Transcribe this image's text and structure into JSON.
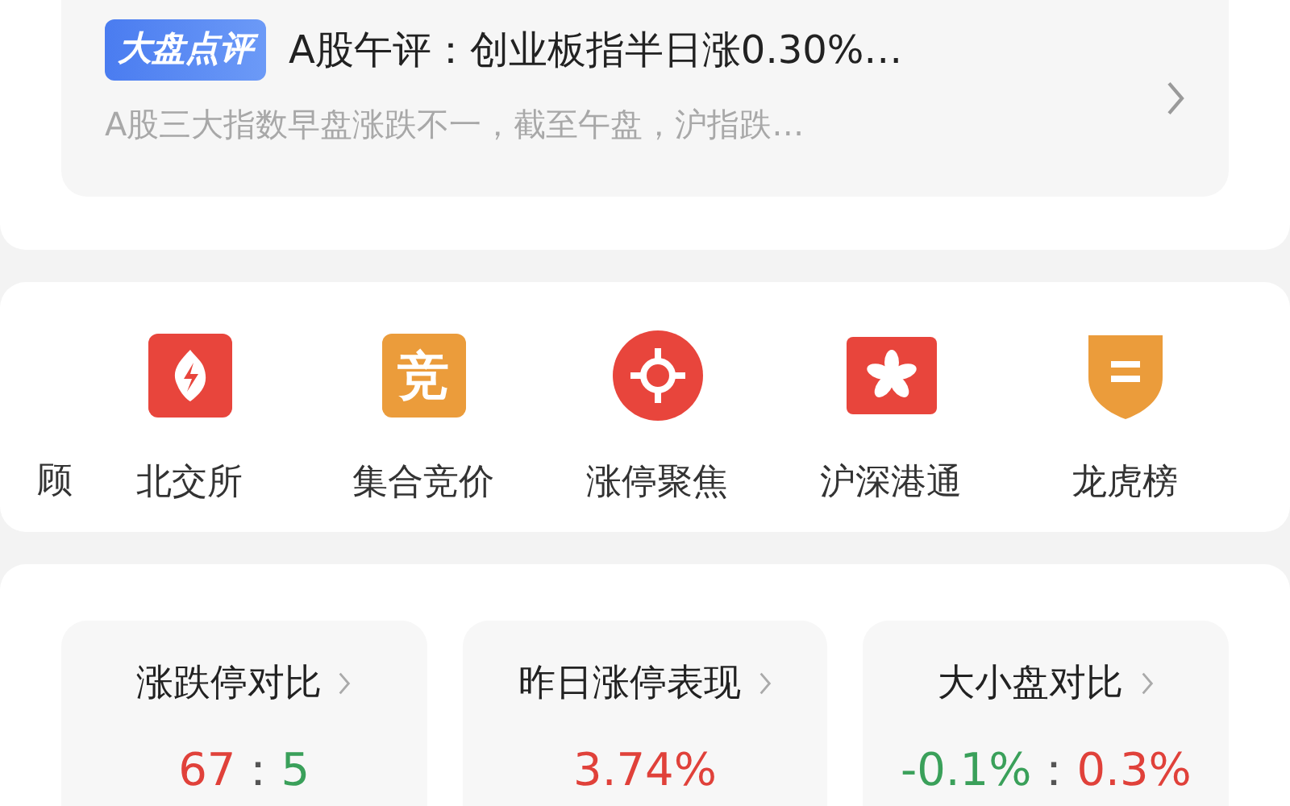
{
  "news": {
    "badge": "大盘点评",
    "title": "A股午评：创业板指半日涨0.30%…",
    "summary": "A股三大指数早盘涨跌不一，截至午盘，沪指跌…"
  },
  "shortcuts": [
    {
      "label": "顾",
      "kind": "cut"
    },
    {
      "label": "北交所",
      "kind": "bolt"
    },
    {
      "label": "集合竞价",
      "kind": "glyph",
      "glyph": "竞"
    },
    {
      "label": "涨停聚焦",
      "kind": "target"
    },
    {
      "label": "沪深港通",
      "kind": "flower"
    },
    {
      "label": "龙虎榜",
      "kind": "shield"
    }
  ],
  "stats": [
    {
      "title": "涨跌停对比",
      "parts": [
        {
          "text": "67",
          "color": "#e0413a"
        },
        {
          "text": "：",
          "color": "#555555"
        },
        {
          "text": "5",
          "color": "#3aa05a"
        }
      ]
    },
    {
      "title": "昨日涨停表现",
      "parts": [
        {
          "text": "3.74%",
          "color": "#e0413a"
        }
      ]
    },
    {
      "title": "大小盘对比",
      "parts": [
        {
          "text": "-0.1%",
          "color": "#3aa05a"
        },
        {
          "text": "：",
          "color": "#555555"
        },
        {
          "text": "0.3%",
          "color": "#e0413a"
        }
      ]
    }
  ]
}
